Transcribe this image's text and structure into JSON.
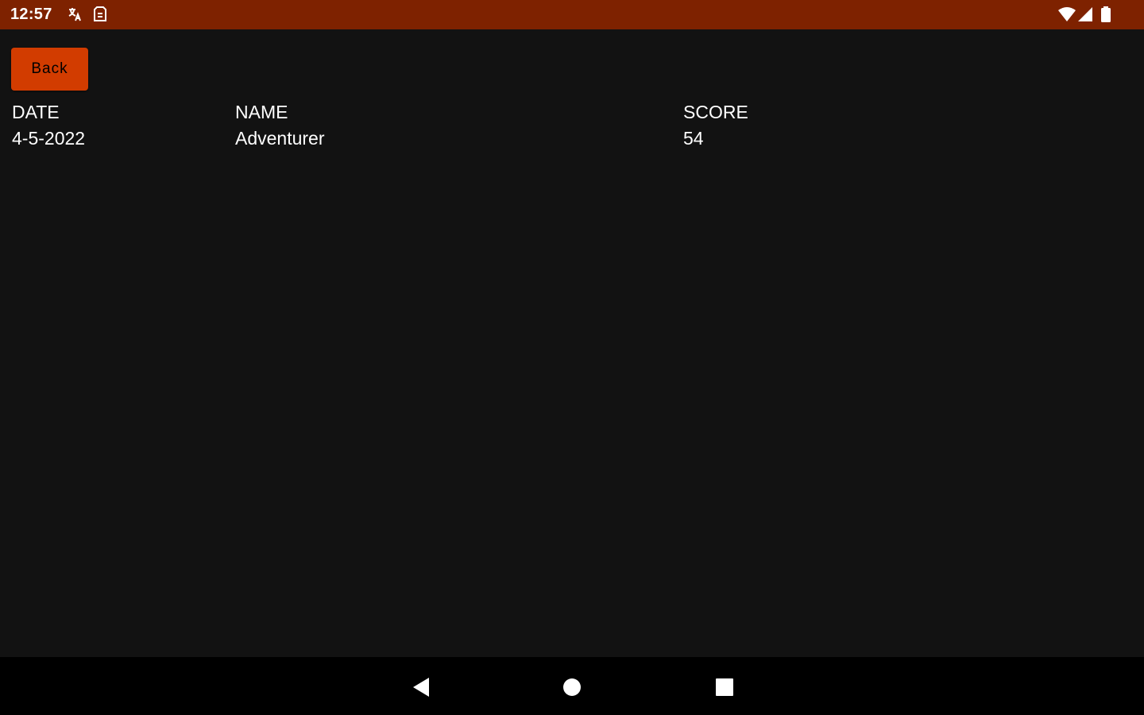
{
  "status_bar": {
    "time": "12:57",
    "bg_color": "#7e2200",
    "left_icons": [
      "translate-icon",
      "sim-card-icon"
    ],
    "right_icons": [
      "wifi-icon",
      "cell-signal-icon",
      "battery-icon"
    ]
  },
  "back_button": {
    "label": "Back",
    "color": "#d23c00"
  },
  "table": {
    "headers": [
      "DATE",
      "NAME",
      "SCORE"
    ],
    "rows": [
      [
        "4-5-2022",
        "Adventurer",
        "54"
      ]
    ]
  },
  "nav_bar": {
    "buttons": [
      "back-triangle-icon",
      "home-circle-icon",
      "recents-square-icon"
    ]
  }
}
